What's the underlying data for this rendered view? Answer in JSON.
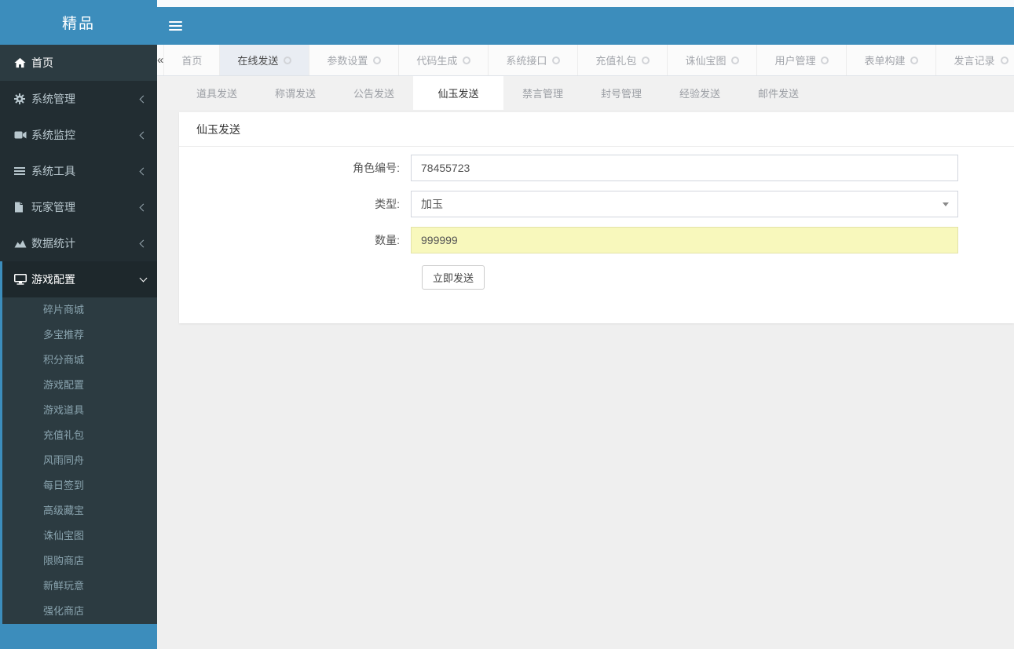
{
  "colors": {
    "accent": "#3c8dbc",
    "sidebar_bg": "#222d32",
    "submenu_bg": "#2c3b41",
    "highlight_yellow": "#f8f8bc",
    "content_bg": "#efefef"
  },
  "sidebar": {
    "brand": "精品",
    "items": [
      {
        "label": "首页",
        "icon": "home-icon"
      },
      {
        "label": "系统管理",
        "icon": "gear-icon",
        "chevron": "left"
      },
      {
        "label": "系统监控",
        "icon": "video-camera-icon",
        "chevron": "left"
      },
      {
        "label": "系统工具",
        "icon": "list-icon",
        "chevron": "left"
      },
      {
        "label": "玩家管理",
        "icon": "file-icon",
        "chevron": "left"
      },
      {
        "label": "数据统计",
        "icon": "chart-icon",
        "chevron": "left"
      },
      {
        "label": "游戏配置",
        "icon": "desktop-icon",
        "chevron": "down",
        "active": true
      }
    ],
    "submenu": [
      {
        "label": "碎片商城"
      },
      {
        "label": "多宝推荐"
      },
      {
        "label": "积分商城"
      },
      {
        "label": "游戏配置"
      },
      {
        "label": "游戏道具"
      },
      {
        "label": "充值礼包"
      },
      {
        "label": "风雨同舟"
      },
      {
        "label": "每日签到"
      },
      {
        "label": "高级藏宝"
      },
      {
        "label": "诛仙宝图"
      },
      {
        "label": "限购商店"
      },
      {
        "label": "新鲜玩意"
      },
      {
        "label": "强化商店"
      }
    ]
  },
  "tabs": {
    "items": [
      {
        "label": "首页",
        "closable": false,
        "active": false
      },
      {
        "label": "在线发送",
        "closable": true,
        "active": true
      },
      {
        "label": "参数设置",
        "closable": true,
        "active": false
      },
      {
        "label": "代码生成",
        "closable": true,
        "active": false
      },
      {
        "label": "系统接口",
        "closable": true,
        "active": false
      },
      {
        "label": "充值礼包",
        "closable": true,
        "active": false
      },
      {
        "label": "诛仙宝图",
        "closable": true,
        "active": false
      },
      {
        "label": "用户管理",
        "closable": true,
        "active": false
      },
      {
        "label": "表单构建",
        "closable": true,
        "active": false
      },
      {
        "label": "发言记录",
        "closable": true,
        "active": false
      }
    ]
  },
  "subtabs": {
    "items": [
      {
        "label": "道具发送",
        "active": false
      },
      {
        "label": "称谓发送",
        "active": false
      },
      {
        "label": "公告发送",
        "active": false
      },
      {
        "label": "仙玉发送",
        "active": true
      },
      {
        "label": "禁言管理",
        "active": false
      },
      {
        "label": "封号管理",
        "active": false
      },
      {
        "label": "经验发送",
        "active": false
      },
      {
        "label": "邮件发送",
        "active": false
      }
    ]
  },
  "panel": {
    "title": "仙玉发送",
    "fields": {
      "role_id": {
        "label": "角色编号:",
        "value": "78455723"
      },
      "type": {
        "label": "类型:",
        "value": "加玉"
      },
      "amount": {
        "label": "数量:",
        "value": "999999"
      }
    },
    "submit_label": "立即发送"
  }
}
